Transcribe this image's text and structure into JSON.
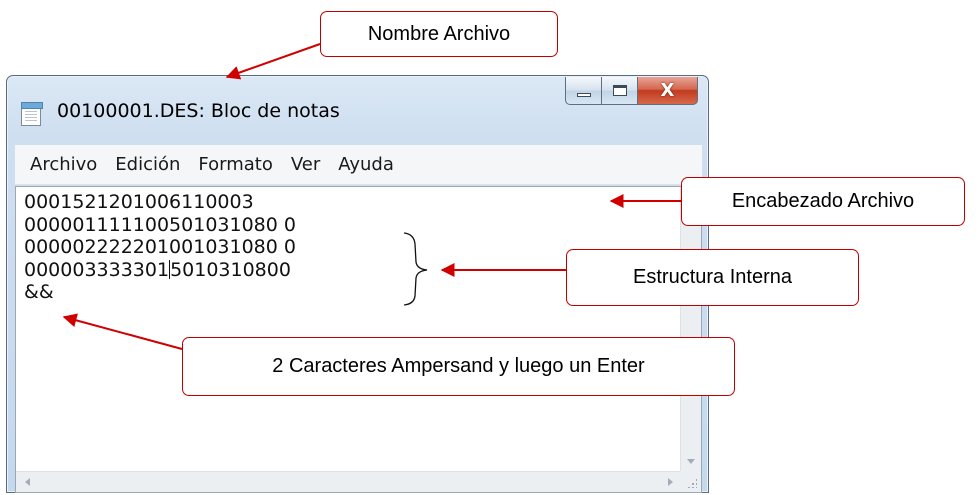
{
  "window": {
    "title": "00100001.DES: Bloc de notas",
    "icon": "notepad-icon",
    "controls": {
      "minimize": "minimize-icon",
      "maximize": "maximize-icon",
      "close": "close-icon",
      "close_glyph": "X"
    }
  },
  "menu": {
    "items": [
      "Archivo",
      "Edición",
      "Formato",
      "Ver",
      "Ayuda"
    ]
  },
  "editor": {
    "lines": [
      "0001521201006110003",
      "000001111100501031080 0",
      "000002222201001031080 0",
      "000003333301",
      "&&"
    ],
    "line4_after_caret": "5010310800"
  },
  "annotations": {
    "filename": "Nombre Archivo",
    "header": "Encabezado Archivo",
    "internal": "Estructura Interna",
    "ampersand": "2 Caracteres Ampersand y luego un Enter",
    "color": "#c00000"
  }
}
